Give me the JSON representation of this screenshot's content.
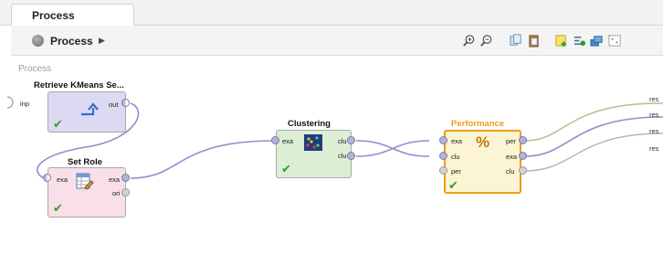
{
  "tab": {
    "label": "Process"
  },
  "toolbar": {
    "process_label": "Process",
    "arrow": "▶"
  },
  "canvas": {
    "title": "Process"
  },
  "input_port_label": "inp",
  "operators": {
    "retrieve": {
      "title": "Retrieve KMeans Se...",
      "ports_out": [
        "out"
      ],
      "bg": "#dcdaf2"
    },
    "set_role": {
      "title": "Set Role",
      "ports_in": [
        "exa"
      ],
      "ports_out": [
        "exa",
        "ori"
      ],
      "bg": "#f8dfe8"
    },
    "clustering": {
      "title": "Clustering",
      "ports_in": [
        "exa"
      ],
      "ports_out": [
        "clu",
        "clu"
      ],
      "bg": "#dcefd5"
    },
    "performance": {
      "title": "Performance",
      "ports_in": [
        "exa",
        "clu",
        "per"
      ],
      "ports_out": [
        "per",
        "exa",
        "clu"
      ],
      "bg": "#fbf5d3",
      "title_color": "#f29b1b"
    }
  },
  "result_ports": [
    "res",
    "res",
    "res",
    "res"
  ],
  "colors": {
    "wire_purple": "#8e8ed0",
    "wire_tan": "#c4b595",
    "wire_grey": "#b8b8b8",
    "check_green": "#3a9a2f",
    "selected_border": "#f29b1b"
  }
}
